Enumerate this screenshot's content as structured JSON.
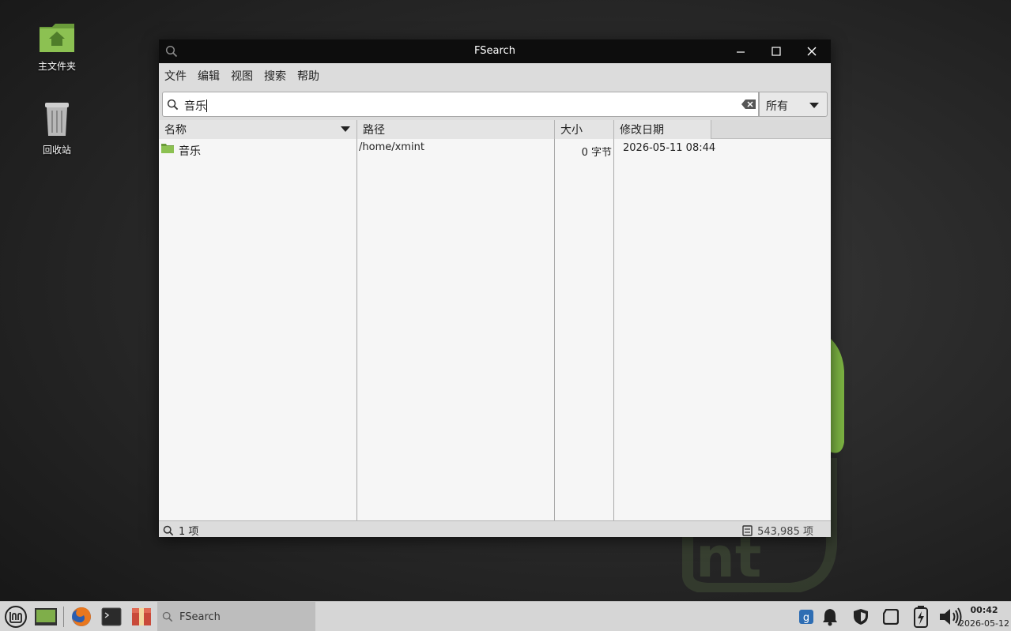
{
  "desktop": {
    "home_label": "主文件夹",
    "trash_label": "回收站"
  },
  "window": {
    "title": "FSearch",
    "menu": [
      "文件",
      "编辑",
      "视图",
      "搜索",
      "帮助"
    ],
    "search_value": "音乐",
    "filter_value": "所有",
    "columns": [
      "名称",
      "路径",
      "大小",
      "修改日期"
    ],
    "rows": [
      {
        "name": "音乐",
        "path": "/home/xmint",
        "size": "0 字节",
        "modified": "2026-05-11 08:44"
      }
    ],
    "status_results": "1 项",
    "status_db": "543,985 项"
  },
  "taskbar": {
    "task_label": "FSearch",
    "time": "00:42",
    "date": "2026-05-12"
  },
  "colors": {
    "accent_green": "#86b943",
    "titlebar": "#0d0d0d"
  }
}
